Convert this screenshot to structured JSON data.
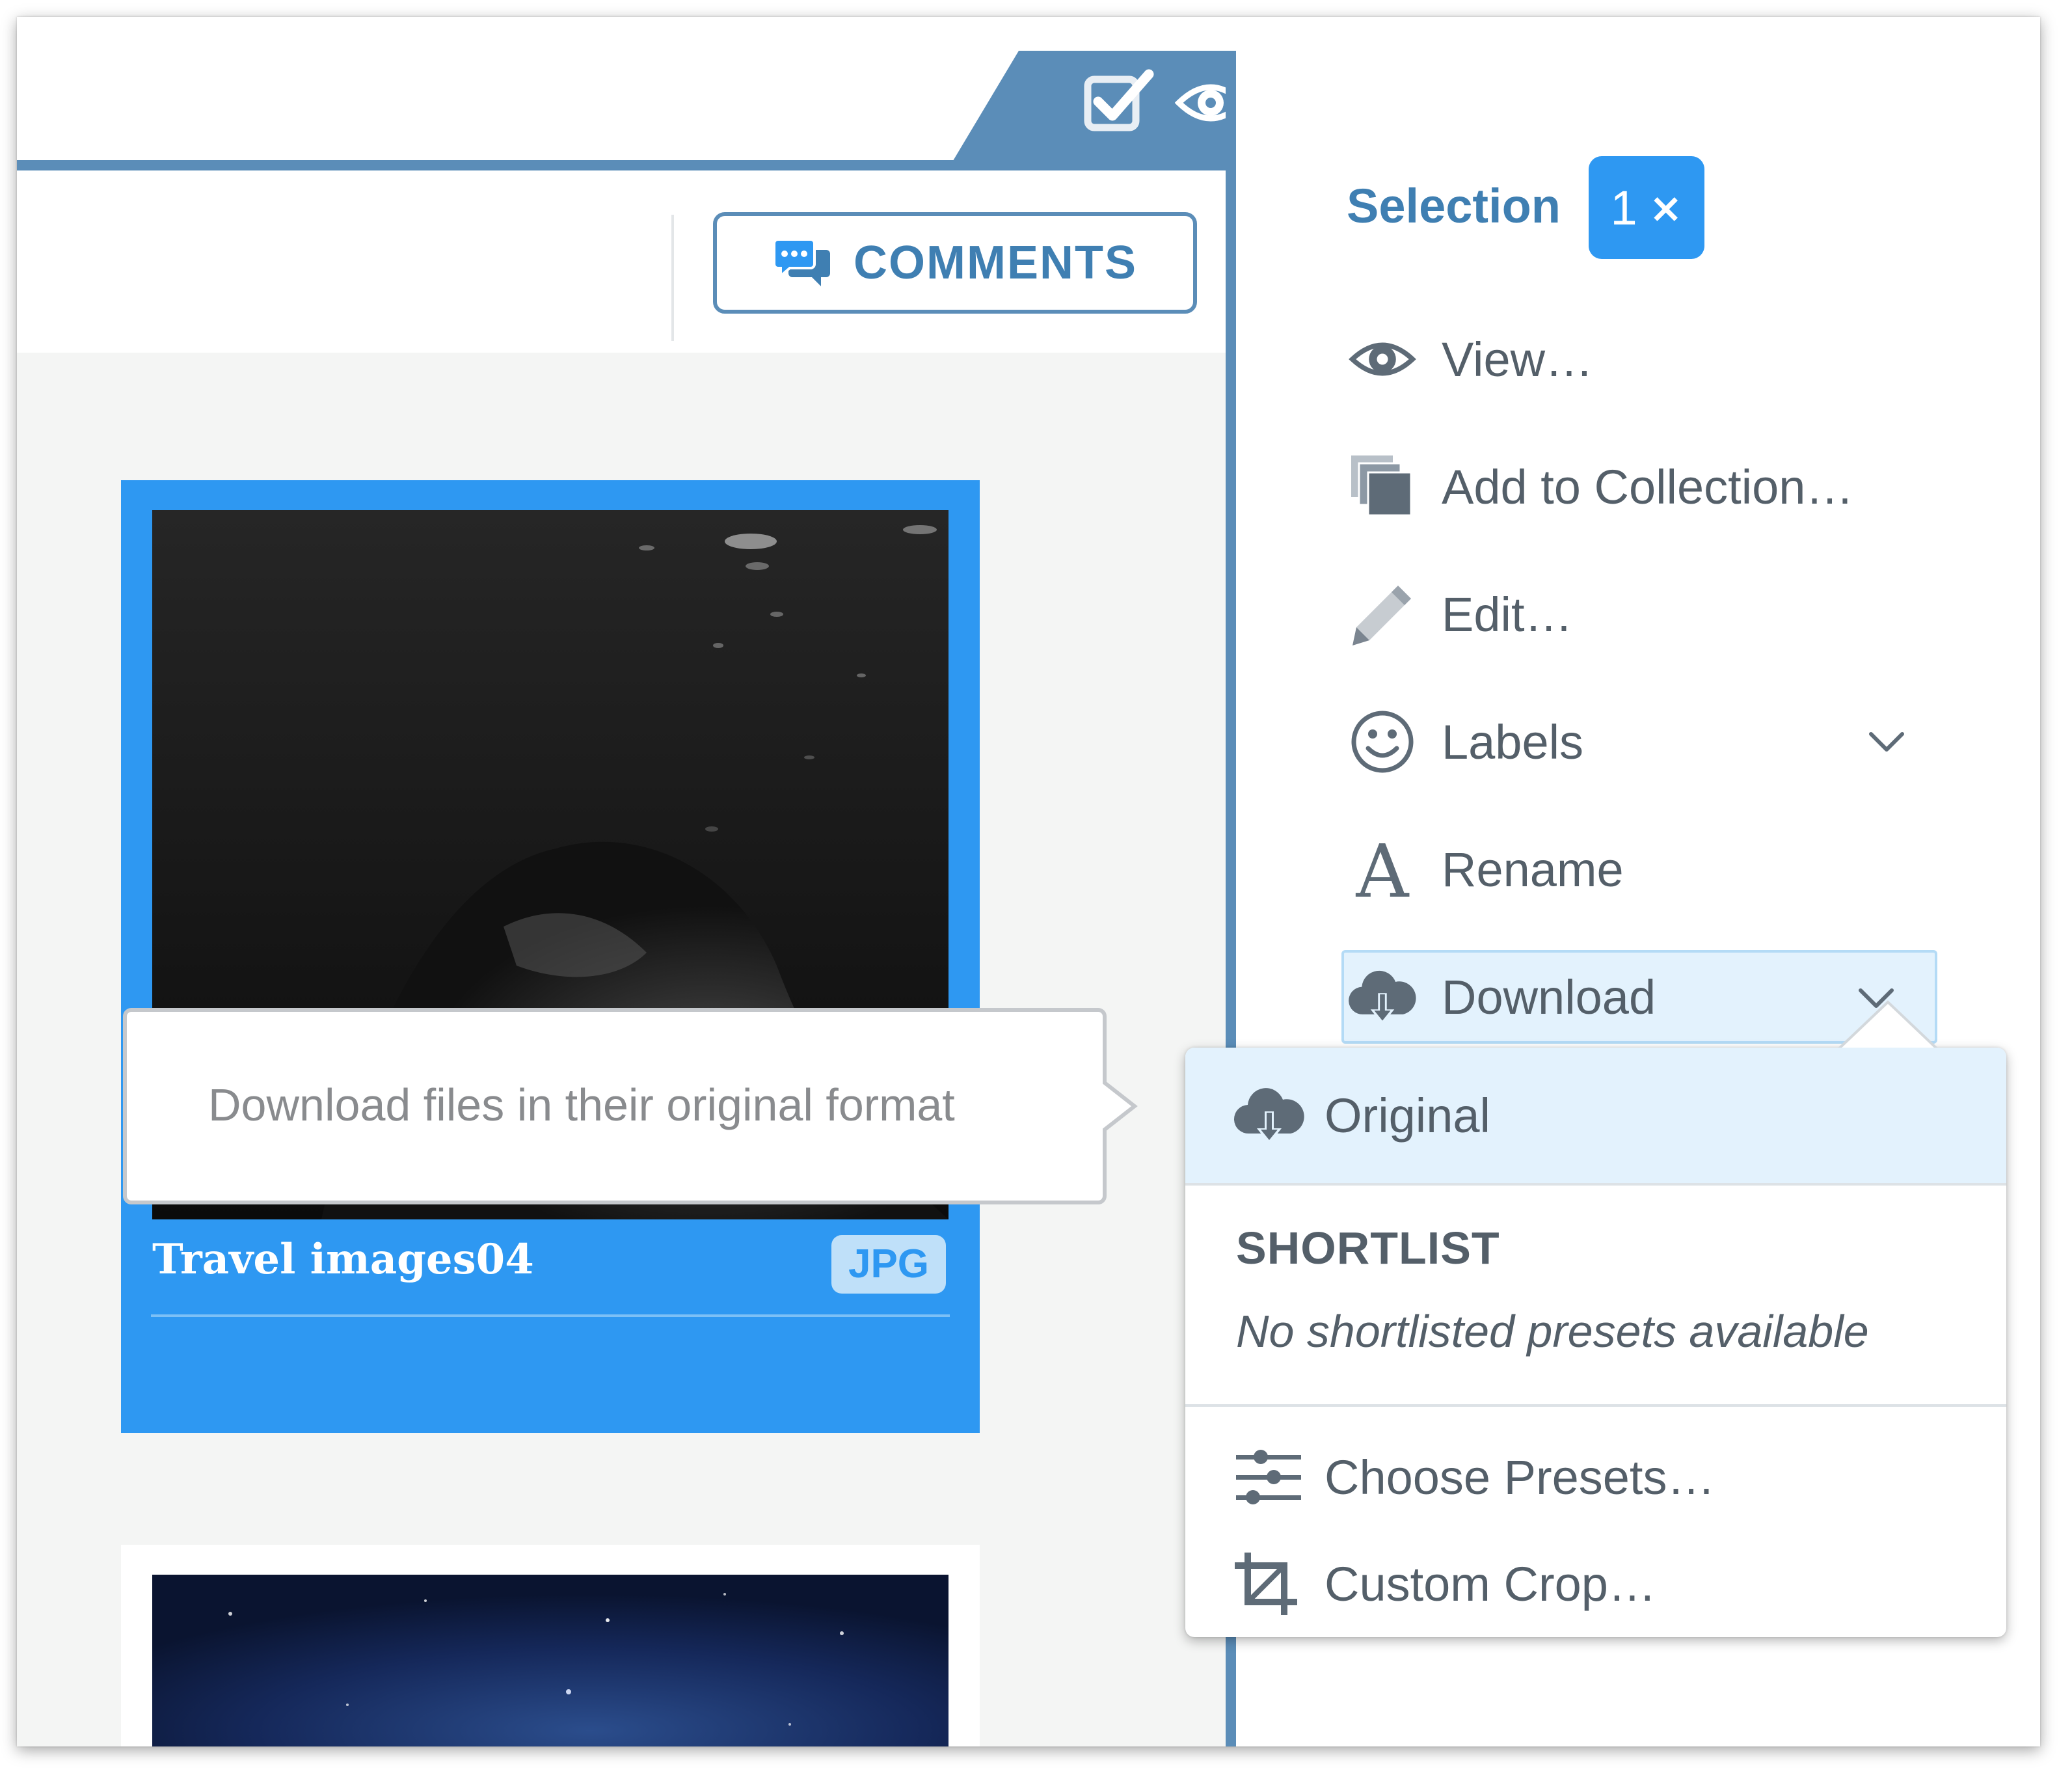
{
  "toolbar": {
    "comments_label": "COMMENTS"
  },
  "tab_icons": [
    "checkbox-check-icon",
    "eye-icon"
  ],
  "gallery": {
    "cards": [
      {
        "title": "Travel images04",
        "format": "JPG",
        "selected": true
      },
      {
        "title": "",
        "format": "",
        "selected": false
      }
    ]
  },
  "tooltip": {
    "text": "Download files in their original format"
  },
  "sidebar": {
    "selection_title": "Selection",
    "selection_count": "1",
    "selection_clear": "×",
    "items": [
      {
        "label": "View…",
        "icon": "eye-icon"
      },
      {
        "label": "Add to Collection…",
        "icon": "collection-stack-icon"
      },
      {
        "label": "Edit…",
        "icon": "pencil-icon"
      },
      {
        "label": "Labels",
        "icon": "smiley-icon",
        "has_dropdown": true
      },
      {
        "label": "Rename",
        "icon": "letter-a-icon"
      },
      {
        "label": "Download",
        "icon": "cloud-download-icon",
        "has_dropdown": true,
        "active": true
      }
    ]
  },
  "download_menu": {
    "original_label": "Original",
    "shortlist_heading": "SHORTLIST",
    "shortlist_empty": "No shortlisted presets available",
    "choose_presets_label": "Choose Presets…",
    "custom_crop_label": "Custom Crop…"
  },
  "colors": {
    "accent_blue": "#2e98f2",
    "steel_blue": "#5b8db8",
    "text_gray": "#545f69",
    "highlight_bg": "#e3f2fd"
  }
}
